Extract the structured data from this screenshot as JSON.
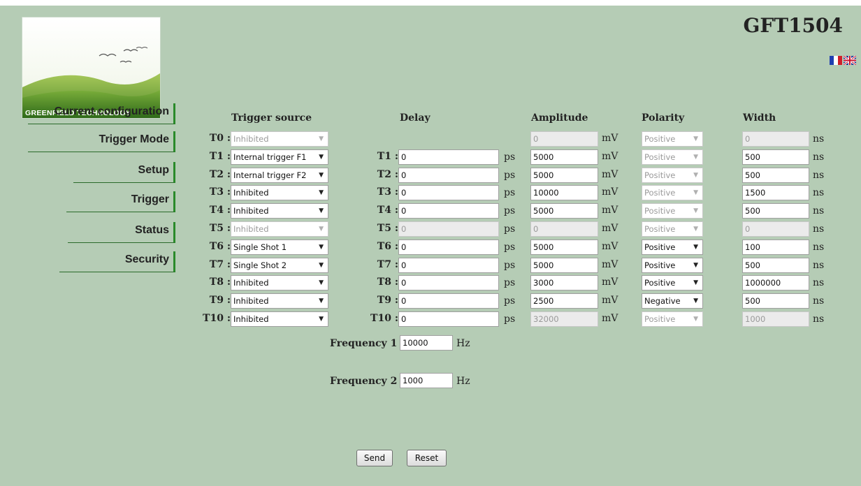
{
  "brand": {
    "logo_text": "GREENFIELD TECHNOLOGY"
  },
  "title": "GFT1504",
  "languages": [
    {
      "name": "french-flag-icon"
    },
    {
      "name": "uk-flag-icon"
    }
  ],
  "nav": [
    {
      "label": "Current configuration"
    },
    {
      "label": "Trigger Mode"
    },
    {
      "label": "Setup"
    },
    {
      "label": "Trigger"
    },
    {
      "label": "Status"
    },
    {
      "label": "Security"
    }
  ],
  "headers": {
    "trigger_source": "Trigger source",
    "delay": "Delay",
    "amplitude": "Amplitude",
    "polarity": "Polarity",
    "width": "Width"
  },
  "units": {
    "delay": "ps",
    "amplitude": "mV",
    "width": "ns",
    "frequency": "Hz"
  },
  "rows": [
    {
      "label": "T0 :",
      "source": "Inhibited",
      "source_disabled": true,
      "delay_label": "",
      "delay": "",
      "delay_disabled": false,
      "amplitude": "0",
      "amplitude_disabled": true,
      "polarity": "Positive",
      "polarity_disabled": true,
      "width": "0",
      "width_disabled": true
    },
    {
      "label": "T1 :",
      "source": "Internal trigger F1",
      "source_disabled": false,
      "delay_label": "T1 :",
      "delay": "0",
      "delay_disabled": false,
      "amplitude": "5000",
      "amplitude_disabled": false,
      "polarity": "Positive",
      "polarity_disabled": true,
      "width": "500",
      "width_disabled": false
    },
    {
      "label": "T2 :",
      "source": "Internal trigger F2",
      "source_disabled": false,
      "delay_label": "T2 :",
      "delay": "0",
      "delay_disabled": false,
      "amplitude": "5000",
      "amplitude_disabled": false,
      "polarity": "Positive",
      "polarity_disabled": true,
      "width": "500",
      "width_disabled": false
    },
    {
      "label": "T3 :",
      "source": "Inhibited",
      "source_disabled": false,
      "delay_label": "T3 :",
      "delay": "0",
      "delay_disabled": false,
      "amplitude": "10000",
      "amplitude_disabled": false,
      "polarity": "Positive",
      "polarity_disabled": true,
      "width": "1500",
      "width_disabled": false
    },
    {
      "label": "T4 :",
      "source": "Inhibited",
      "source_disabled": false,
      "delay_label": "T4 :",
      "delay": "0",
      "delay_disabled": false,
      "amplitude": "5000",
      "amplitude_disabled": false,
      "polarity": "Positive",
      "polarity_disabled": true,
      "width": "500",
      "width_disabled": false
    },
    {
      "label": "T5 :",
      "source": "Inhibited",
      "source_disabled": true,
      "delay_label": "T5 :",
      "delay": "0",
      "delay_disabled": true,
      "amplitude": "0",
      "amplitude_disabled": true,
      "polarity": "Positive",
      "polarity_disabled": true,
      "width": "0",
      "width_disabled": true
    },
    {
      "label": "T6 :",
      "source": "Single Shot 1",
      "source_disabled": false,
      "delay_label": "T6 :",
      "delay": "0",
      "delay_disabled": false,
      "amplitude": "5000",
      "amplitude_disabled": false,
      "polarity": "Positive",
      "polarity_disabled": false,
      "width": "100",
      "width_disabled": false
    },
    {
      "label": "T7 :",
      "source": "Single Shot 2",
      "source_disabled": false,
      "delay_label": "T7 :",
      "delay": "0",
      "delay_disabled": false,
      "amplitude": "5000",
      "amplitude_disabled": false,
      "polarity": "Positive",
      "polarity_disabled": false,
      "width": "500",
      "width_disabled": false
    },
    {
      "label": "T8 :",
      "source": "Inhibited",
      "source_disabled": false,
      "delay_label": "T8 :",
      "delay": "0",
      "delay_disabled": false,
      "amplitude": "3000",
      "amplitude_disabled": false,
      "polarity": "Positive",
      "polarity_disabled": false,
      "width": "1000000",
      "width_disabled": false
    },
    {
      "label": "T9 :",
      "source": "Inhibited",
      "source_disabled": false,
      "delay_label": "T9 :",
      "delay": "0",
      "delay_disabled": false,
      "amplitude": "2500",
      "amplitude_disabled": false,
      "polarity": "Negative",
      "polarity_disabled": false,
      "width": "500",
      "width_disabled": false
    },
    {
      "label": "T10 :",
      "source": "Inhibited",
      "source_disabled": false,
      "delay_label": "T10 :",
      "delay": "0",
      "delay_disabled": false,
      "amplitude": "32000",
      "amplitude_disabled": true,
      "polarity": "Positive",
      "polarity_disabled": true,
      "width": "1000",
      "width_disabled": true
    }
  ],
  "frequencies": [
    {
      "label": "Frequency 1 :",
      "value": "10000"
    },
    {
      "label": "Frequency 2 :",
      "value": "1000"
    }
  ],
  "buttons": {
    "send": "Send",
    "reset": "Reset"
  }
}
